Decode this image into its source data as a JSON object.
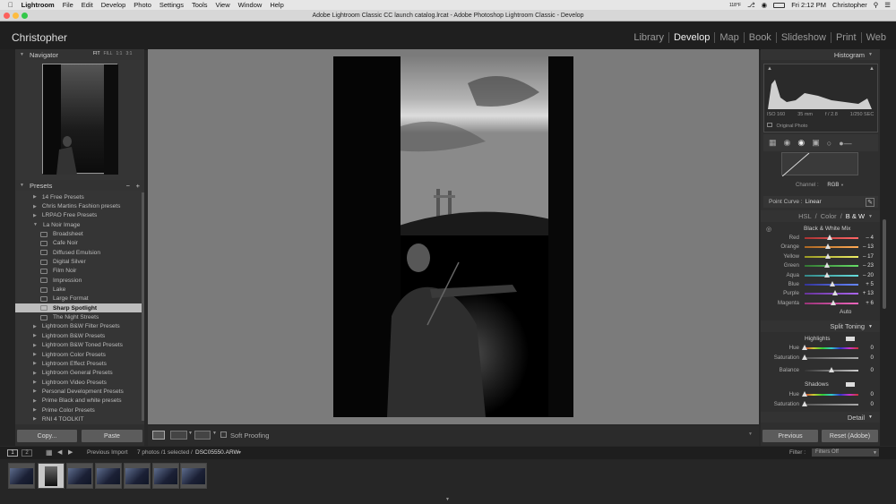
{
  "menubar": {
    "app": "Lightroom",
    "items": [
      "File",
      "Edit",
      "Develop",
      "Photo",
      "Settings",
      "Tools",
      "View",
      "Window",
      "Help"
    ],
    "weather": "118°F",
    "time": "Fri 2:12 PM",
    "user": "Christopher"
  },
  "window": {
    "title": "Adobe Lightroom Classic CC launch catalog.lrcat - Adobe Photoshop Lightroom Classic - Develop"
  },
  "identity": {
    "name": "Christopher"
  },
  "modules": [
    {
      "label": "Library"
    },
    {
      "label": "Develop",
      "active": true
    },
    {
      "label": "Map"
    },
    {
      "label": "Book"
    },
    {
      "label": "Slideshow"
    },
    {
      "label": "Print"
    },
    {
      "label": "Web"
    }
  ],
  "navigator": {
    "title": "Navigator",
    "zoom": [
      "FIT",
      "FILL",
      "1:1",
      "3:1"
    ]
  },
  "presets": {
    "title": "Presets",
    "items": [
      {
        "label": "14 Free Presets",
        "level": 0
      },
      {
        "label": "Chris Martins Fashion presets",
        "level": 0
      },
      {
        "label": "LRPAO Free Presets",
        "level": 0
      },
      {
        "label": "La Noir Image",
        "level": 0,
        "open": true
      },
      {
        "label": "Broadsheet",
        "level": 1
      },
      {
        "label": "Cafe Noir",
        "level": 1
      },
      {
        "label": "Diffused Emulsion",
        "level": 1
      },
      {
        "label": "Digital Silver",
        "level": 1
      },
      {
        "label": "Film Noir",
        "level": 1
      },
      {
        "label": "Impression",
        "level": 1
      },
      {
        "label": "Lake",
        "level": 1
      },
      {
        "label": "Large Format",
        "level": 1
      },
      {
        "label": "Sharp Spotlight",
        "level": 1,
        "selected": true
      },
      {
        "label": "The Night Streets",
        "level": 1
      },
      {
        "label": "Lightroom B&W Filter Presets",
        "level": 0
      },
      {
        "label": "Lightroom B&W Presets",
        "level": 0
      },
      {
        "label": "Lightroom B&W Toned Presets",
        "level": 0
      },
      {
        "label": "Lightroom Color Presets",
        "level": 0
      },
      {
        "label": "Lightroom Effect Presets",
        "level": 0
      },
      {
        "label": "Lightroom General Presets",
        "level": 0
      },
      {
        "label": "Lightroom Video Presets",
        "level": 0
      },
      {
        "label": "Personal Development Presets",
        "level": 0
      },
      {
        "label": "Prime Black and white presets",
        "level": 0
      },
      {
        "label": "Prime Color Presets",
        "level": 0
      },
      {
        "label": "RNI 4 TOOLKIT",
        "level": 0
      }
    ]
  },
  "left_buttons": {
    "copy": "Copy...",
    "paste": "Paste"
  },
  "toolbar": {
    "soft_proofing": "Soft Proofing"
  },
  "histogram": {
    "title": "Histogram",
    "iso": "ISO 160",
    "focal": "35 mm",
    "aperture": "f / 2.8",
    "shutter": "1/250 SEC",
    "original": "Original Photo"
  },
  "tone_curve": {
    "channel_label": "Channel :",
    "channel": "RGB",
    "point_curve_label": "Point Curve :",
    "point_curve": "Linear"
  },
  "hsl": {
    "hsl": "HSL",
    "sep1": "/",
    "color": "Color",
    "sep2": "/",
    "bw": "B & W"
  },
  "bw_mix": {
    "title": "Black & White Mix",
    "auto": "Auto",
    "sliders": [
      {
        "label": "Red",
        "value": "– 4",
        "pos": 0.47,
        "c1": "#aa3333",
        "c2": "#ff6666"
      },
      {
        "label": "Orange",
        "value": "– 13",
        "pos": 0.44,
        "c1": "#aa6622",
        "c2": "#ffaa55"
      },
      {
        "label": "Yellow",
        "value": "– 17",
        "pos": 0.43,
        "c1": "#999922",
        "c2": "#eeee66"
      },
      {
        "label": "Green",
        "value": "– 23",
        "pos": 0.41,
        "c1": "#337733",
        "c2": "#66dd66"
      },
      {
        "label": "Aqua",
        "value": "– 20",
        "pos": 0.42,
        "c1": "#338888",
        "c2": "#66dddd"
      },
      {
        "label": "Blue",
        "value": "+ 5",
        "pos": 0.52,
        "c1": "#333399",
        "c2": "#6688ff"
      },
      {
        "label": "Purple",
        "value": "+ 13",
        "pos": 0.56,
        "c1": "#663399",
        "c2": "#aa66ee"
      },
      {
        "label": "Magenta",
        "value": "+ 6",
        "pos": 0.53,
        "c1": "#993377",
        "c2": "#ee66bb"
      }
    ]
  },
  "split_toning": {
    "title": "Split Toning",
    "highlights": "Highlights",
    "shadows": "Shadows",
    "balance": "Balance",
    "h_hue": {
      "label": "Hue",
      "value": "0"
    },
    "h_sat": {
      "label": "Saturation",
      "value": "0"
    },
    "bal": {
      "label": "Balance",
      "value": "0"
    },
    "s_hue": {
      "label": "Hue",
      "value": "0"
    },
    "s_sat": {
      "label": "Saturation",
      "value": "0"
    }
  },
  "detail": {
    "title": "Detail"
  },
  "right_buttons": {
    "previous": "Previous",
    "reset": "Reset (Adobe)"
  },
  "filmstrip": {
    "page1": "1",
    "page2": "2",
    "source": "Previous Import",
    "count": "7 photos /1 selected /",
    "file": "DSC05550.ARW",
    "filter_label": "Filter :",
    "filter": "Filters Off"
  }
}
